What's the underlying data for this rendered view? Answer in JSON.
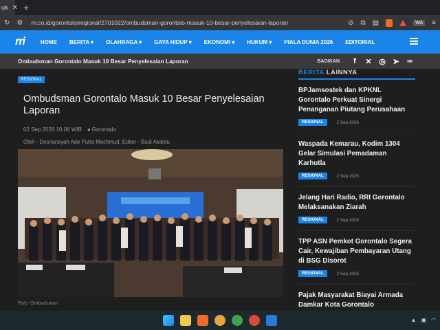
{
  "browser": {
    "tab_label": "uk",
    "new_tab": "+",
    "url": "rri.co.id/gorontalo/regional/2701022/ombudsman-gorontalo-masuk-10-besar-penyelesaian-laporan",
    "profile_badge": "WA"
  },
  "nav": {
    "logo": "rri",
    "menu": [
      "HOME",
      "BERITA ▾",
      "OLAHRAGA ▾",
      "GAYA HIDUP ▾",
      "EKONOMI ▾",
      "HUKUM ▾",
      "PIALA DUNIA 2026",
      "EDITORIAL"
    ]
  },
  "subbar": {
    "title": "Ombudsman Gorontalo Masuk 10 Besar Penyelesaian Laporan",
    "share_label": "BAGIKAN"
  },
  "article": {
    "category": "REGIONAL",
    "title": "Ombudsman Gorontalo Masuk 10 Besar Penyelesaian Laporan",
    "date": "02 Sep 2026 10:06 WIB",
    "location": "Gorontalo",
    "byline": "Oleh - Desriansyah Ade Putra Machmud,    Editor - Budi Akantu",
    "caption": "Foto: Ombudsman"
  },
  "sidebar": {
    "head_a": "BERITA",
    "head_b": " LAINNYA",
    "items": [
      {
        "title": "BPJamsostek dan KPKNL Gorontalo Perkuat Sinergi Penanganan Piutang Perusahaan",
        "badge": "REGIONAL",
        "date": "2 Sep 2026"
      },
      {
        "title": "Waspada Kemarau, Kodim 1304 Gelar Simulasi Pemadaman Karhutla",
        "badge": "REGIONAL",
        "date": "2 Sep 2026"
      },
      {
        "title": "Jelang Hari Radio, RRI Gorontalo Melaksanakan Ziarah",
        "badge": "REGIONAL",
        "date": "2 Sep 2026"
      },
      {
        "title": "TPP ASN Pemkot Gorontalo Segera Cair, Kewajiban Pembayaran Utang di BSG Disorot",
        "badge": "REGIONAL",
        "date": "2 Sep 2026"
      },
      {
        "title": "Pajak Masyarakat Biayai Armada Damkar Kota Gorontalo",
        "badge": "",
        "date": ""
      }
    ]
  },
  "colors": {
    "accent": "#1a84e8",
    "background": "#1e1e1e"
  }
}
